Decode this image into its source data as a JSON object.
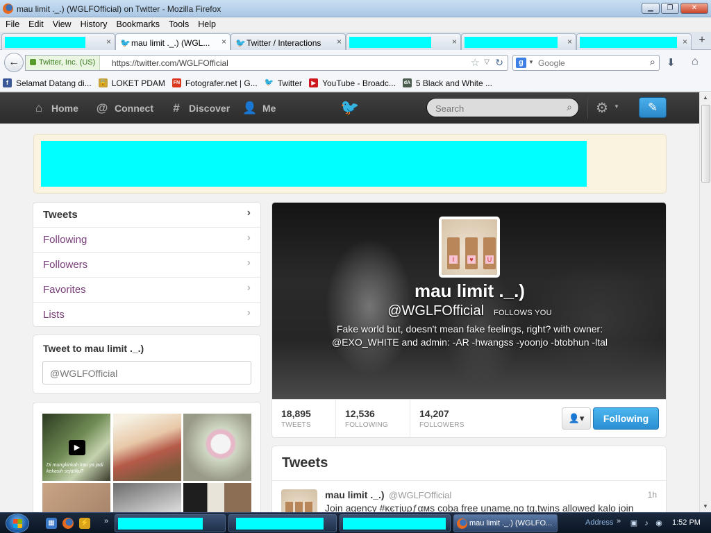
{
  "window": {
    "title": "mau limit ._.) (WGLFOfficial) on Twitter - Mozilla Firefox",
    "buttons": {
      "minimize": "▁",
      "maximize": "❐",
      "close": "✕"
    }
  },
  "menu": [
    "File",
    "Edit",
    "View",
    "History",
    "Bookmarks",
    "Tools",
    "Help"
  ],
  "tabs": [
    {
      "label": "",
      "redacted": true,
      "active": false
    },
    {
      "label": "mau limit ._.) (WGL...",
      "redacted": false,
      "active": true
    },
    {
      "label": "Twitter / Interactions",
      "redacted": false,
      "active": false
    },
    {
      "label": "",
      "redacted": true,
      "active": false
    },
    {
      "label": "",
      "redacted": true,
      "active": false
    },
    {
      "label": "",
      "redacted": true,
      "active": false
    }
  ],
  "tab_close_glyph": "×",
  "new_tab_glyph": "+",
  "navbar": {
    "identity": "Twitter, Inc. (US)",
    "url": "https://twitter.com/WGLFOfficial",
    "search_engine": "Google"
  },
  "bookmarks": [
    {
      "label": "Selamat Datang di...",
      "icon": "facebook-icon",
      "color": "#3b5998",
      "glyph": "f"
    },
    {
      "label": "LOKET PDAM",
      "icon": "lock-icon",
      "color": "#c8a23a",
      "glyph": "🔒"
    },
    {
      "label": "Fotografer.net | G...",
      "icon": "fn-icon",
      "color": "#d9381e",
      "glyph": "FN"
    },
    {
      "label": "Twitter",
      "icon": "twitter-bird-icon",
      "color": "#2aa3e3",
      "glyph": "🐦"
    },
    {
      "label": "YouTube - Broadc...",
      "icon": "youtube-icon",
      "color": "#cc181e",
      "glyph": "▶"
    },
    {
      "label": "5 Black and White ...",
      "icon": "deviantart-icon",
      "color": "#4a5d4e",
      "glyph": "dA"
    }
  ],
  "twitter": {
    "nav": {
      "home": "Home",
      "connect": "Connect",
      "discover": "Discover",
      "me": "Me"
    },
    "search_placeholder": "Search",
    "left_nav": [
      {
        "label": "Tweets",
        "active": true
      },
      {
        "label": "Following",
        "active": false
      },
      {
        "label": "Followers",
        "active": false
      },
      {
        "label": "Favorites",
        "active": false
      },
      {
        "label": "Lists",
        "active": false
      }
    ],
    "tweet_to": {
      "heading": "Tweet to mau limit ._.)",
      "value": "@WGLFOfficial"
    },
    "profile": {
      "name": "mau limit ._.)",
      "screen_name": "@WGLFOfficial",
      "follows_you": "FOLLOWS YOU",
      "bio_line1": "Fake world but, doesn't mean fake feelings, right? with owner:",
      "bio_line2": "@EXO_WHITE and admin: -AR -hwangss -yoonjo -btobhun -ltal",
      "avatar_letters": [
        "I",
        "♥",
        "U"
      ]
    },
    "stats": [
      {
        "num": "18,895",
        "label": "TWEETS"
      },
      {
        "num": "12,536",
        "label": "FOLLOWING"
      },
      {
        "num": "14,207",
        "label": "FOLLOWERS"
      }
    ],
    "following_button": "Following",
    "stream": {
      "heading": "Tweets",
      "tweet": {
        "name": "mau limit ._.)",
        "screen_name": "@WGLFOfficial",
        "time": "1h",
        "text": "Join agency #κєтjυρƒαмs coba free uname,no tg,twins allowed kalo join"
      }
    },
    "photo_caption": "Di mungkinkah kau ya jadi kekasih sejatiku?"
  },
  "taskbar": {
    "active_task": "mau limit ._.) (WGLFO...",
    "address_label": "Address",
    "clock": "1:52 PM",
    "quicklaunch_more": "»"
  }
}
